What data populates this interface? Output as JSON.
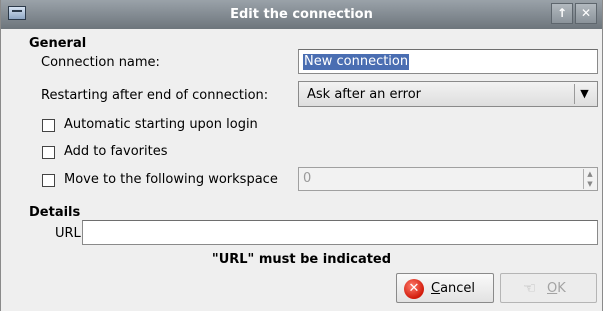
{
  "window": {
    "title": "Edit the connection"
  },
  "titlebar": {
    "icon": "window-menu-icon",
    "maximize_glyph": "↑",
    "close_glyph": "✕"
  },
  "general": {
    "heading": "General",
    "connection_name_label": "Connection name:",
    "connection_name_value": "New connection",
    "restart_label": "Restarting after end of connection:",
    "restart_value": "Ask after an error",
    "auto_start_label": "Automatic starting upon login",
    "auto_start_checked": false,
    "favorites_label": "Add to favorites",
    "favorites_checked": false,
    "workspace_label": "Move to the following workspace",
    "workspace_checked": false,
    "workspace_value": "0"
  },
  "details": {
    "heading": "Details",
    "url_label": "URL:",
    "url_value": ""
  },
  "message": "\"URL\" must be indicated",
  "buttons": {
    "cancel_mnemonic": "C",
    "cancel_rest": "ancel",
    "ok_mnemonic": "O",
    "ok_rest": "K"
  }
}
